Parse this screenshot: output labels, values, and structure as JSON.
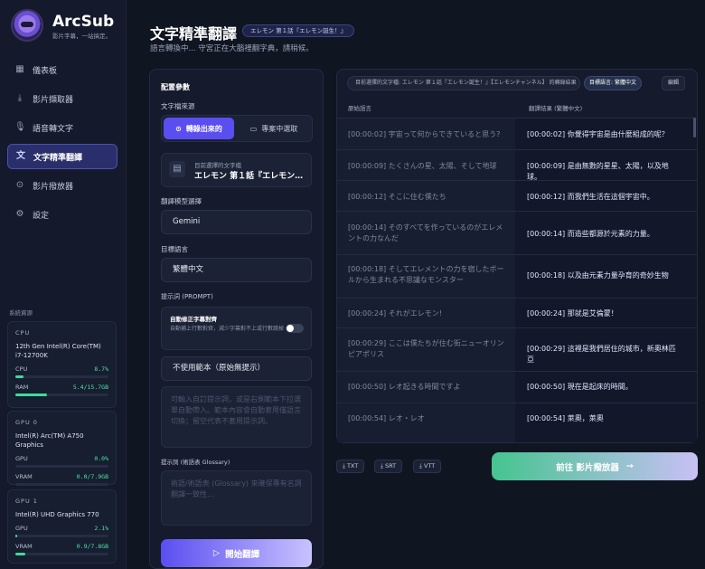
{
  "app": {
    "name": "ArcSub",
    "tagline": "影片字幕，一站搞定。"
  },
  "nav": [
    {
      "label": "儀表板",
      "icon": "grid-icon"
    },
    {
      "label": "影片擷取器",
      "icon": "download-icon"
    },
    {
      "label": "語音轉文字",
      "icon": "mic-icon"
    },
    {
      "label": "文字精準翻譯",
      "icon": "translate-icon"
    },
    {
      "label": "影片撥放器",
      "icon": "play-circle-icon"
    },
    {
      "label": "設定",
      "icon": "gear-icon"
    }
  ],
  "system": {
    "title": "系統資源",
    "cpu": {
      "title": "CPU",
      "name": "12th Gen Intel(R) Core(TM) i7-12700K",
      "cpu_label": "CPU",
      "cpu_value": "8.7%",
      "cpu_pct": 8.7,
      "ram_label": "RAM",
      "ram_value": "5.4/15.7GB",
      "ram_pct": 34
    },
    "gpu0": {
      "title": "GPU 0",
      "name": "Intel(R) Arc(TM) A750 Graphics",
      "gpu_label": "GPU",
      "gpu_value": "0.0%",
      "gpu_pct": 0,
      "vram_label": "VRAM",
      "vram_value": "0.0/7.9GB",
      "vram_pct": 0
    },
    "gpu1": {
      "title": "GPU 1",
      "name": "Intel(R) UHD Graphics 770",
      "gpu_label": "GPU",
      "gpu_value": "2.1%",
      "gpu_pct": 2.1,
      "vram_label": "VRAM",
      "vram_value": "0.9/7.8GB",
      "vram_pct": 11
    }
  },
  "page": {
    "title": "文字精準翻譯",
    "badge": "エレモン 第１話『エレモン誕生！』",
    "subtitle": "語言轉換中... 守宮正在大腦裡翻字典，請稍候。"
  },
  "config": {
    "heading": "配置參數",
    "source_label": "文字檔來源",
    "source_opt1": "轉錄出來的",
    "source_opt2": "專案中選取",
    "file_caption": "目前選擇的文字檔",
    "file_name": "エレモン 第１話『エレモン誕生！』",
    "model_label": "翻譯模型選擇",
    "model_value": "Gemini",
    "lang_label": "目標語言",
    "lang_value": "繁體中文",
    "prompt_label": "提示詞 (PROMPT)",
    "toggle_title": "自動修正字幕對齊",
    "toggle_desc": "自動補上行數對齊，減少字幕對不上或行數跳掉",
    "template_value": "不使用範本（原始無提示）",
    "prompt_placeholder": "可輸入自訂提示詞，或是右側範本下拉選單自動帶入。範本內容會自動套用僅語言切換；留空代表不套用提示詞。",
    "glossary_label": "提示詞 (術語表 Glossary)",
    "glossary_placeholder": "術語/術語表 (Glossary) 來確保專有名詞翻譯一致性...",
    "start_label": "開始翻譯"
  },
  "result": {
    "header": "目前選擇的文字檔: エレモン 第１話『エレモン誕生！』【エレモンチャンネル】 的轉錄結果",
    "lang_badge": "目標語言: 繁體中文",
    "edit_label": "編輯",
    "col_source": "原始語言",
    "col_target": "翻譯結果 (繁體中文)",
    "rows": [
      {
        "src": "[00:00:02] 宇宙って何からできていると思う?",
        "dst": "[00:00:02] 你覺得宇宙是由什麼組成的呢？"
      },
      {
        "src": "[00:00:09] たくさんの星、太陽、そして地球",
        "dst": "[00:00:09] 是由無數的星星、太陽，以及地球。"
      },
      {
        "src": "[00:00:12] そこに住む僕たち",
        "dst": "[00:00:12] 而我們生活在這個宇宙中。"
      },
      {
        "src": "[00:00:14] そのすべてを作っているのがエレメントの力なんだ",
        "dst": "[00:00:14] 而造些都源於元素的力量。"
      },
      {
        "src": "[00:00:18] そしてエレメントの力を宿したボールから生まれる不思議なモンスター",
        "dst": "[00:00:18] 以及由元素力量孕育的奇妙生物"
      },
      {
        "src": "[00:00:24] それがエレモン!",
        "dst": "[00:00:24] 那就是艾倫蒙！"
      },
      {
        "src": "[00:00:29] ここは僕たちが住む街ニューオリンピアポリス",
        "dst": "[00:00:29] 這裡是我們居住的城市，新奧林匹亞"
      },
      {
        "src": "[00:00:50] レオ起きる時間ですよ",
        "dst": "[00:00:50] 現在是起床的時間。"
      },
      {
        "src": "[00:00:54] レオ・レオ",
        "dst": "[00:00:54] 萊奧，萊奧"
      }
    ]
  },
  "export": {
    "txt": "TXT",
    "srt": "SRT",
    "vtt": "VTT",
    "go_label": "前往 影片撥放器"
  }
}
